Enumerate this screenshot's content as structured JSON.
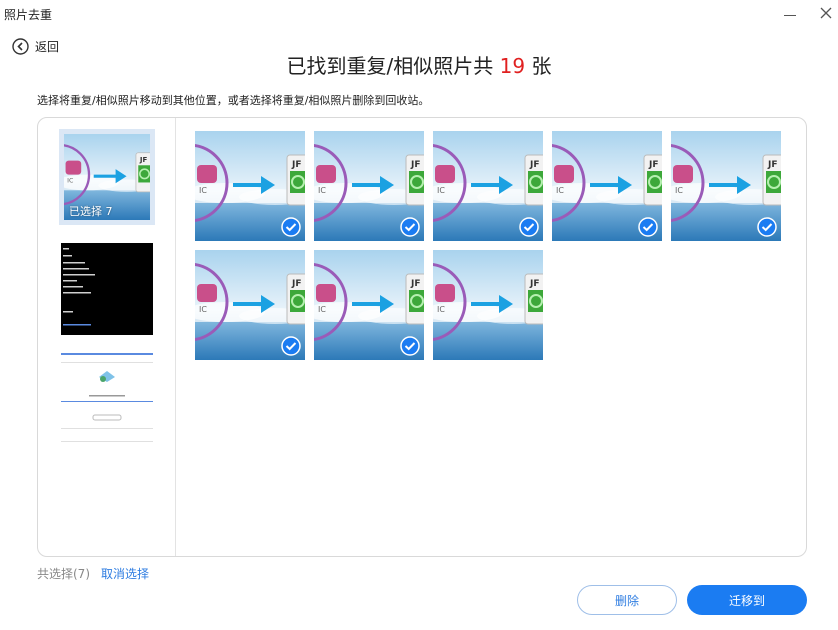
{
  "window": {
    "title": "照片去重"
  },
  "nav": {
    "back_label": "返回"
  },
  "header": {
    "prefix": "已找到重复/相似照片共 ",
    "count": "19",
    "suffix": " 张"
  },
  "instruction": "选择将重复/相似照片移动到其他位置，或者选择将重复/相似照片删除到回收站。",
  "groups": [
    {
      "badge": "已选择 7",
      "selected": true
    },
    {
      "badge": "",
      "selected": false
    },
    {
      "badge": "",
      "selected": false
    }
  ],
  "photos": [
    {
      "checked": true
    },
    {
      "checked": true
    },
    {
      "checked": true
    },
    {
      "checked": true
    },
    {
      "checked": true
    },
    {
      "checked": true
    },
    {
      "checked": true
    },
    {
      "checked": false
    }
  ],
  "footer": {
    "selected_count": "共选择(7)",
    "cancel_label": "取消选择"
  },
  "actions": {
    "delete_label": "删除",
    "move_label": "迁移到"
  },
  "colors": {
    "accent": "#1b7cf2",
    "count_red": "#e02020",
    "link": "#2f7de1"
  }
}
